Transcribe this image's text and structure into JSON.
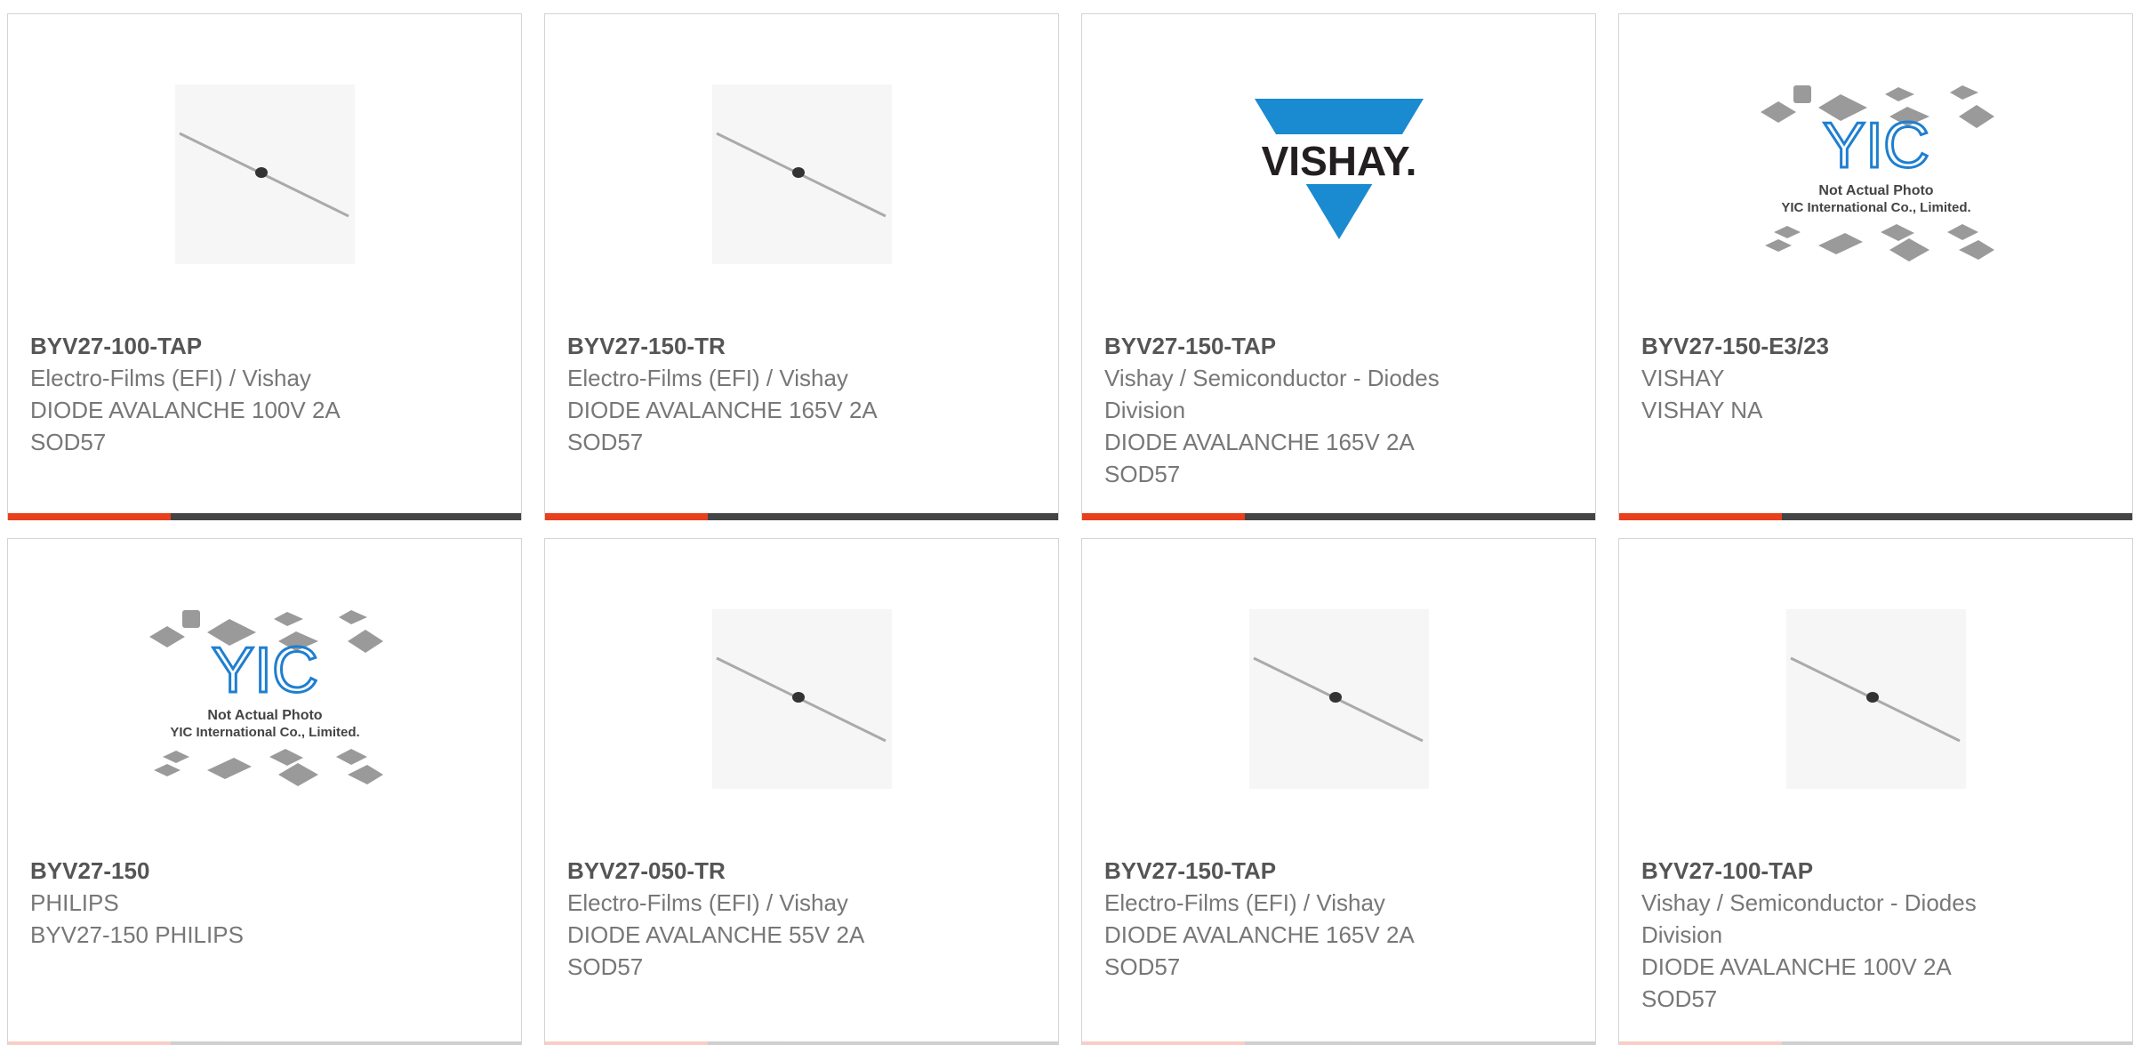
{
  "products": [
    {
      "part": "BYV27-100-TAP",
      "lines": [
        "Electro-Films (EFI) / Vishay",
        "DIODE AVALANCHE 100V 2A",
        "SOD57"
      ],
      "image": "diode-axial-icon"
    },
    {
      "part": "BYV27-150-TR",
      "lines": [
        "Electro-Films (EFI) / Vishay",
        "DIODE AVALANCHE 165V 2A",
        "SOD57"
      ],
      "image": "diode-axial-icon"
    },
    {
      "part": "BYV27-150-TAP",
      "lines": [
        "Vishay / Semiconductor - Diodes",
        "Division",
        "DIODE AVALANCHE 165V 2A",
        "SOD57"
      ],
      "image": "vishay-logo",
      "logo_text": "VISHAY."
    },
    {
      "part": "BYV27-150-E3/23",
      "lines": [
        "VISHAY",
        "VISHAY NA"
      ],
      "image": "yic-placeholder-icon",
      "placeholder_text": [
        "Not Actual Photo",
        "YIC International Co., Limited."
      ]
    },
    {
      "part": "BYV27-150",
      "lines": [
        "PHILIPS",
        "BYV27-150 PHILIPS"
      ],
      "image": "yic-placeholder-icon",
      "placeholder_text": [
        "Not Actual Photo",
        "YIC International Co., Limited."
      ]
    },
    {
      "part": "BYV27-050-TR",
      "lines": [
        "Electro-Films (EFI) / Vishay",
        "DIODE AVALANCHE 55V 2A",
        "SOD57"
      ],
      "image": "diode-axial-icon"
    },
    {
      "part": "BYV27-150-TAP",
      "lines": [
        "Electro-Films (EFI) / Vishay",
        "DIODE AVALANCHE 165V 2A",
        "SOD57"
      ],
      "image": "diode-axial-icon"
    },
    {
      "part": "BYV27-100-TAP",
      "lines": [
        "Vishay / Semiconductor - Diodes",
        "Division",
        "DIODE AVALANCHE 100V 2A",
        "SOD57"
      ],
      "image": "diode-axial-icon"
    }
  ],
  "colors": {
    "accent": "#e8401d",
    "bar": "#444444",
    "vishay_blue": "#1a8ad1",
    "yic_blue": "#1e7fd0"
  }
}
